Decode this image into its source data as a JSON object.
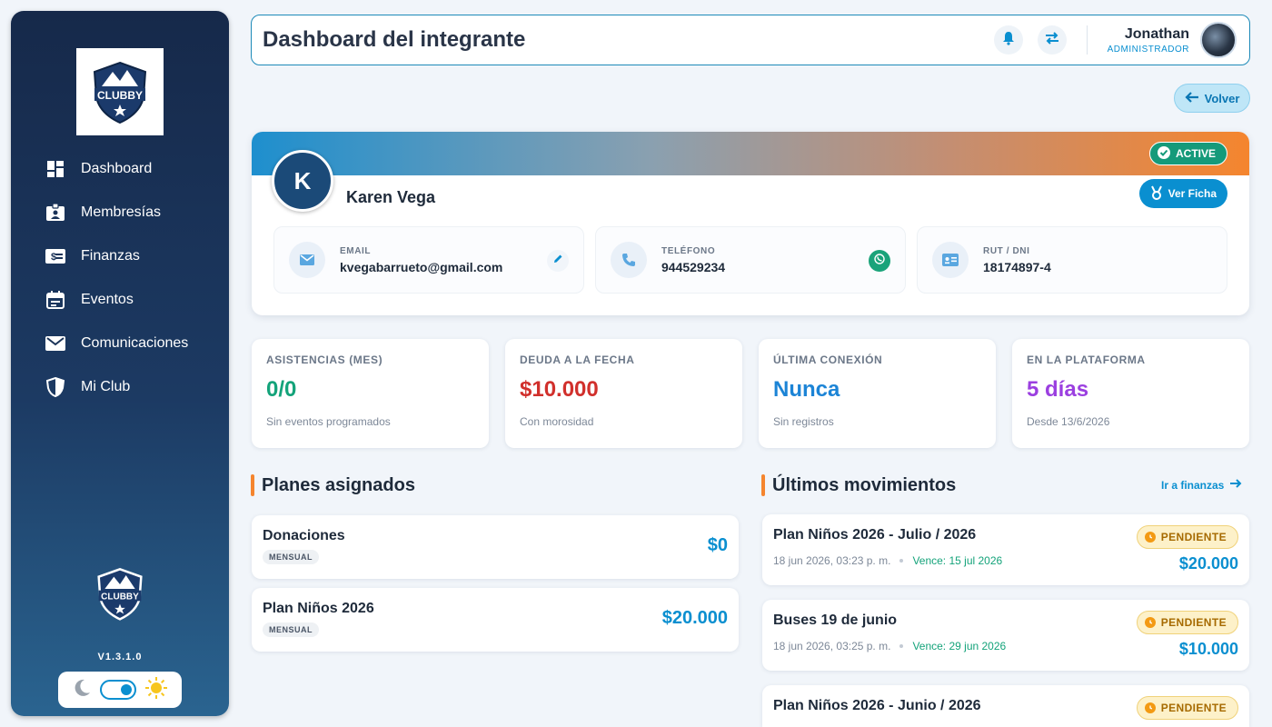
{
  "sidebar": {
    "logo_text": "CLUBBY",
    "items": [
      {
        "label": "Dashboard",
        "icon": "dashboard-icon"
      },
      {
        "label": "Membresías",
        "icon": "id-badge-icon"
      },
      {
        "label": "Finanzas",
        "icon": "money-icon"
      },
      {
        "label": "Eventos",
        "icon": "calendar-icon"
      },
      {
        "label": "Comunicaciones",
        "icon": "mail-icon"
      },
      {
        "label": "Mi Club",
        "icon": "shield-icon"
      }
    ],
    "version": "V1.3.1.0"
  },
  "header": {
    "title": "Dashboard del integrante",
    "user_name": "Jonathan",
    "user_role": "ADMINISTRADOR"
  },
  "back_label": "Volver",
  "profile": {
    "initial": "K",
    "name": "Karen Vega",
    "status": "ACTIVE",
    "ver_ficha": "Ver Ficha",
    "email_label": "EMAIL",
    "email": "kvegabarrueto@gmail.com",
    "phone_label": "TELÉFONO",
    "phone": "944529234",
    "rut_label": "RUT / DNI",
    "rut": "18174897-4"
  },
  "stats": [
    {
      "label": "ASISTENCIAS (MES)",
      "value": "0/0",
      "sub": "Sin eventos programados",
      "color": "#14a37a"
    },
    {
      "label": "DEUDA A LA FECHA",
      "value": "$10.000",
      "sub": "Con morosidad",
      "color": "#d1302c"
    },
    {
      "label": "ÚLTIMA CONEXIÓN",
      "value": "Nunca",
      "sub": "Sin registros",
      "color": "#1c84d6"
    },
    {
      "label": "EN LA PLATAFORMA",
      "value": "5 días",
      "sub": "Desde 13/6/2026",
      "color": "#9b3fe0"
    }
  ],
  "plans_title": "Planes asignados",
  "plans": [
    {
      "name": "Donaciones",
      "badge": "MENSUAL",
      "price": "$0"
    },
    {
      "name": "Plan Niños 2026",
      "badge": "MENSUAL",
      "price": "$20.000"
    }
  ],
  "movements_title": "Últimos movimientos",
  "finanzas_link": "Ir a finanzas",
  "movements": [
    {
      "title": "Plan Niños 2026 - Julio / 2026",
      "date": "18 jun 2026, 03:23 p. m.",
      "due": "Vence: 15 jul 2026",
      "status": "PENDIENTE",
      "amount": "$20.000"
    },
    {
      "title": "Buses 19 de junio",
      "date": "18 jun 2026, 03:25 p. m.",
      "due": "Vence: 29 jun 2026",
      "status": "PENDIENTE",
      "amount": "$10.000"
    },
    {
      "title": "Plan Niños 2026 - Junio / 2026",
      "date": "",
      "due": "",
      "status": "PENDIENTE",
      "amount": ""
    }
  ]
}
